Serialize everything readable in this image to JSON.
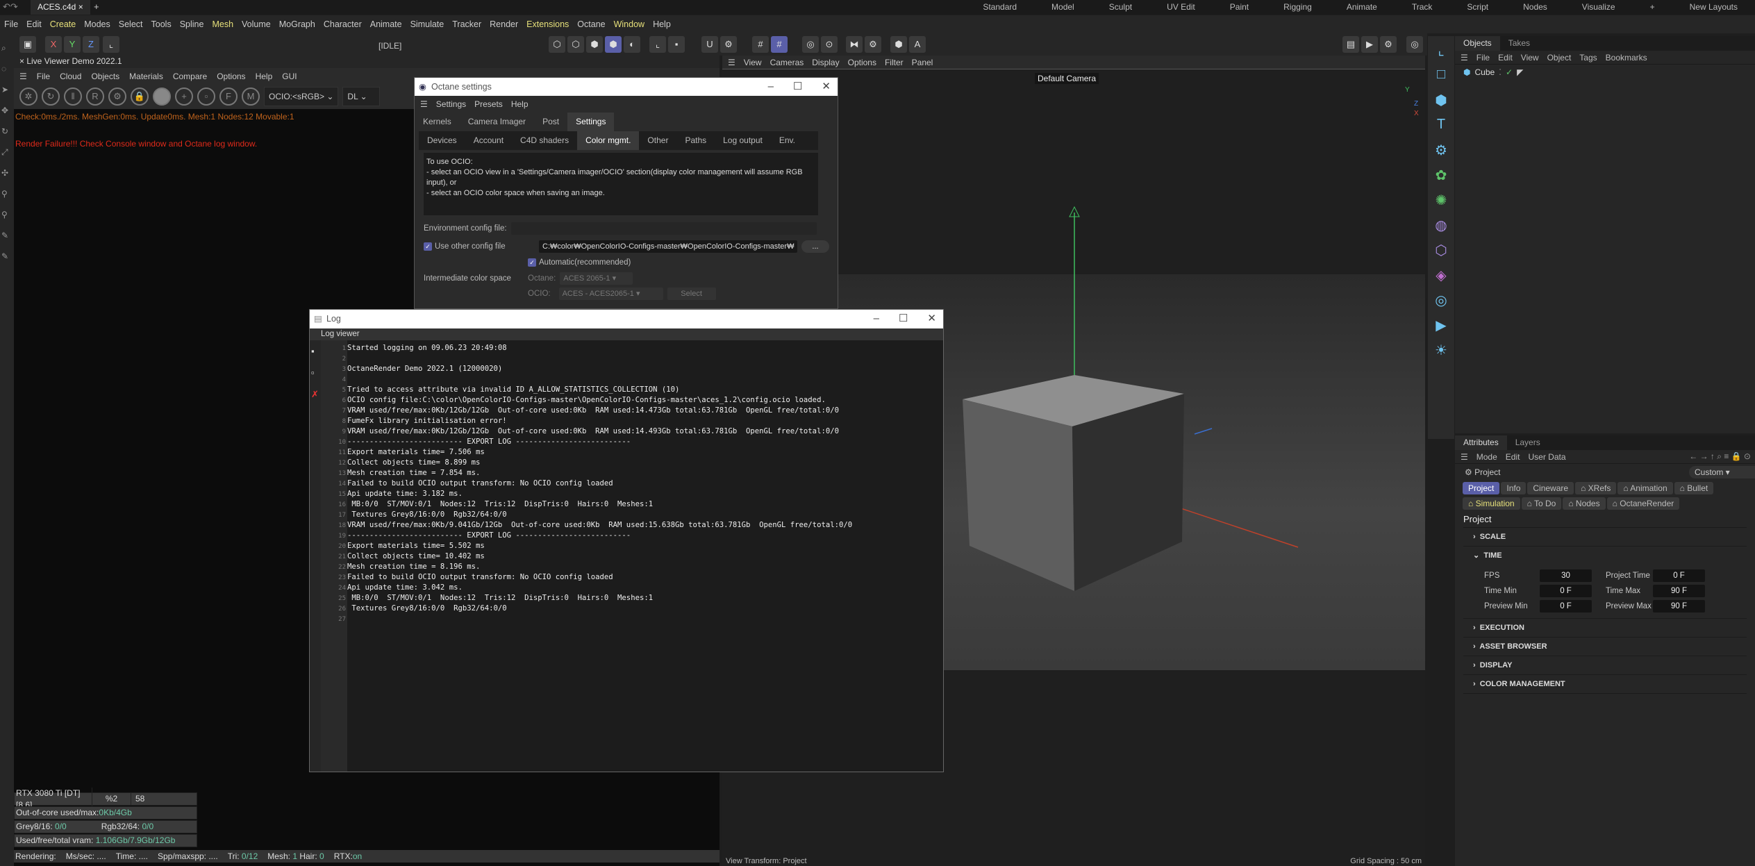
{
  "file_tab": "ACES.c4d",
  "layouts": [
    "Standard",
    "Model",
    "Sculpt",
    "UV Edit",
    "Paint",
    "Rigging",
    "Animate",
    "Track",
    "Script",
    "Nodes",
    "Visualize",
    "+",
    "New Layouts"
  ],
  "menu": [
    "File",
    "Edit",
    "Create",
    "Modes",
    "Select",
    "Tools",
    "Spline",
    "Mesh",
    "Volume",
    "MoGraph",
    "Character",
    "Animate",
    "Simulate",
    "Tracker",
    "Render",
    "Extensions",
    "Octane",
    "Window",
    "Help"
  ],
  "axis_buttons": [
    "X",
    "Y",
    "Z"
  ],
  "live_viewer": {
    "title": "Live Viewer Demo 2022.1",
    "menu": [
      "File",
      "Cloud",
      "Objects",
      "Materials",
      "Compare",
      "Options",
      "Help",
      "GUI"
    ],
    "state": "[IDLE]",
    "ocio_select": "OCIO:<sRGB>",
    "mode_select": "DL",
    "check_msg": "Check:0ms./2ms. MeshGen:0ms. Update0ms. Mesh:1 Nodes:12 Movable:1",
    "error_msg": "Render Failure!!! Check Console window and Octane log window.",
    "gpu": "RTX 3080 Ti [DT][8.6]",
    "gpu_pct": "%2",
    "gpu_temp": "58",
    "ooc_label": "Out-of-core used/max:",
    "ooc_value": "0Kb/4Gb",
    "grey_label": "Grey8/16: ",
    "grey_value": "0/0",
    "rgb_label": "Rgb32/64: ",
    "rgb_value": "0/0",
    "vram_label": "Used/free/total vram: ",
    "vram_value": "1.106Gb/7.9Gb/12Gb",
    "status": {
      "rendering": "Rendering:",
      "ms": "Ms/sec: ....",
      "time": "Time: ....",
      "spp": "Spp/maxspp: ....",
      "tri_label": "Tri:",
      "tri": "0/12",
      "mesh_label": "Mesh:",
      "mesh": "1",
      "hair_label": "Hair:",
      "hair": "0",
      "rtx_label": "RTX:",
      "rtx": "on"
    }
  },
  "viewport": {
    "menu": [
      "View",
      "Cameras",
      "Display",
      "Options",
      "Filter",
      "Panel"
    ],
    "camera": "Default Camera",
    "view_transform": "View Transform: Project",
    "grid_spacing": "Grid Spacing : 50 cm"
  },
  "objects": {
    "tabs": [
      "Objects",
      "Takes"
    ],
    "menu": [
      "File",
      "Edit",
      "View",
      "Object",
      "Tags",
      "Bookmarks"
    ],
    "items": [
      {
        "name": "Cube"
      }
    ]
  },
  "attributes": {
    "tabs": [
      "Attributes",
      "Layers"
    ],
    "menu": [
      "Mode",
      "Edit",
      "User Data"
    ],
    "object": "Project",
    "preset": "Custom",
    "chips": [
      "Project",
      "Info",
      "Cineware",
      "⌂ XRefs",
      "⌂ Animation",
      "⌂ Bullet",
      "⌂ Simulation",
      "⌂ To Do",
      "⌂ Nodes",
      "⌂ OctaneRender"
    ],
    "heading": "Project",
    "sections": [
      "SCALE",
      "TIME",
      "EXECUTION",
      "ASSET BROWSER",
      "DISPLAY",
      "COLOR MANAGEMENT"
    ],
    "time": {
      "fps_label": "FPS",
      "fps": "30",
      "project_time_label": "Project Time",
      "project_time": "0 F",
      "time_min_label": "Time Min",
      "time_min": "0 F",
      "time_max_label": "Time Max",
      "time_max": "90 F",
      "preview_min_label": "Preview Min",
      "preview_min": "0 F",
      "preview_max_label": "Preview Max",
      "preview_max": "90 F"
    }
  },
  "octane_settings": {
    "title": "Octane settings",
    "menu": [
      "Settings",
      "Presets",
      "Help"
    ],
    "tabs": [
      "Kernels",
      "Camera Imager",
      "Post",
      "Settings"
    ],
    "subtabs": [
      "Devices",
      "Account",
      "C4D shaders",
      "Color mgmt.",
      "Other",
      "Paths",
      "Log output",
      "Env."
    ],
    "info": "To use OCIO:\n- select an OCIO view in a 'Settings/Camera imager/OCIO' section(display color management will assume RGB input), or\n- select an OCIO color space when saving an image.",
    "env_label": "Environment config file:",
    "use_other_label": "Use other config file",
    "config_path": "C:₩color₩OpenColorIO-Configs-master₩OpenColorIO-Configs-master₩",
    "browse": "...",
    "automatic_label": "Automatic(recommended)",
    "intermediate_label": "Intermediate color space",
    "octane_label": "Octane:",
    "octane_value": "ACES 2065-1",
    "ocio_label": "OCIO:",
    "ocio_value": "ACES - ACES2065-1",
    "select": "Select"
  },
  "log": {
    "title": "Log",
    "subtitle": "Log viewer",
    "lines": [
      "Started logging on 09.06.23 20:49:08",
      "",
      "OctaneRender Demo 2022.1 (12000020)",
      "",
      "Tried to access attribute via invalid ID A_ALLOW_STATISTICS_COLLECTION (10)",
      "OCIO config file:C:\\color\\OpenColorIO-Configs-master\\OpenColorIO-Configs-master\\aces_1.2\\config.ocio loaded.",
      "VRAM used/free/max:0Kb/12Gb/12Gb  Out-of-core used:0Kb  RAM used:14.473Gb total:63.781Gb  OpenGL free/total:0/0",
      "FumeFx library initialisation error!",
      "VRAM used/free/max:0Kb/12Gb/12Gb  Out-of-core used:0Kb  RAM used:14.493Gb total:63.781Gb  OpenGL free/total:0/0",
      "-------------------------- EXPORT LOG --------------------------",
      "Export materials time= 7.506 ms",
      "Collect objects time= 8.899 ms",
      "Mesh creation time = 7.854 ms.",
      "Failed to build OCIO output transform: No OCIO config loaded",
      "Api update time: 3.182 ms.",
      " MB:0/0  ST/MOV:0/1  Nodes:12  Tris:12  DispTris:0  Hairs:0  Meshes:1",
      " Textures Grey8/16:0/0  Rgb32/64:0/0",
      "VRAM used/free/max:0Kb/9.041Gb/12Gb  Out-of-core used:0Kb  RAM used:15.638Gb total:63.781Gb  OpenGL free/total:0/0",
      "-------------------------- EXPORT LOG --------------------------",
      "Export materials time= 5.502 ms",
      "Collect objects time= 10.402 ms",
      "Mesh creation time = 8.196 ms.",
      "Failed to build OCIO output transform: No OCIO config loaded",
      "Api update time: 3.042 ms.",
      " MB:0/0  ST/MOV:0/1  Nodes:12  Tris:12  DispTris:0  Hairs:0  Meshes:1",
      " Textures Grey8/16:0/0  Rgb32/64:0/0",
      ""
    ]
  },
  "colors": {
    "accent": "#5a5fa8",
    "highlight_menu": "#e6e07a",
    "value_green": "#6dc9a8",
    "error_red": "#e02a1a",
    "warn_orange": "#c0631c"
  }
}
